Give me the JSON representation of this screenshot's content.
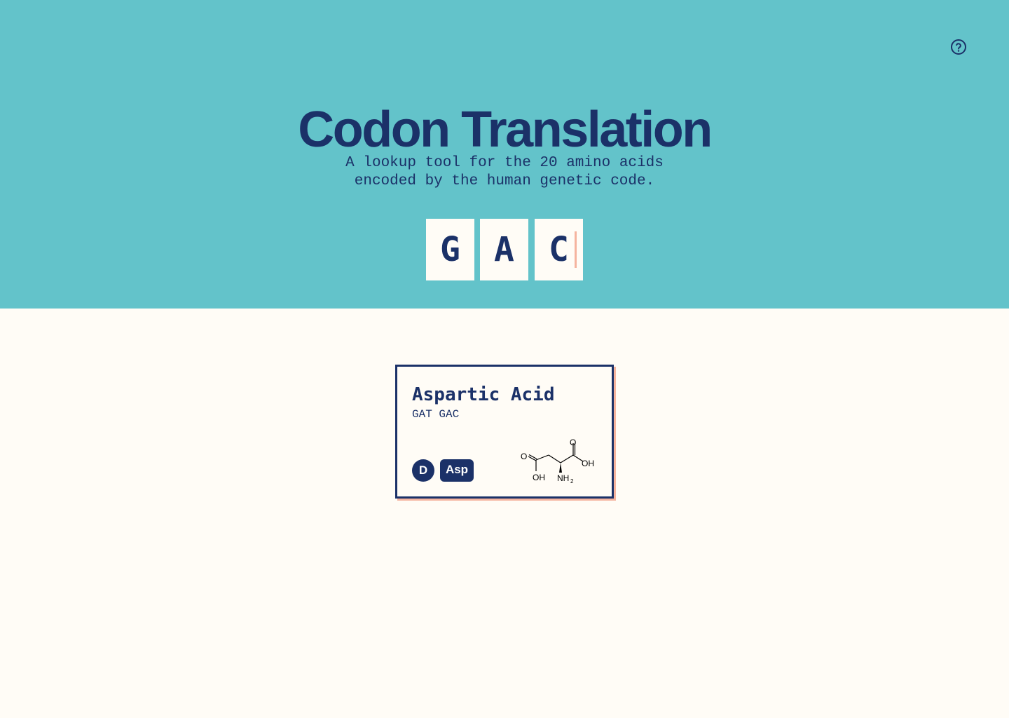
{
  "header": {
    "title": "Codon Translation",
    "subtitle_line1": "A lookup tool for the 20 amino acids",
    "subtitle_line2": "encoded by the human genetic code.",
    "help_icon": "question-circle-icon"
  },
  "codon_input": {
    "bases": [
      "G",
      "A",
      "C"
    ]
  },
  "result_card": {
    "name": "Aspartic Acid",
    "codons": "GAT GAC",
    "one_letter": "D",
    "three_letter": "Asp",
    "structure_labels": {
      "o_left": "O",
      "oh_left": "OH",
      "o_right": "O",
      "oh_right": "OH",
      "nh": "NH",
      "nh_sub": "2"
    }
  },
  "colors": {
    "hero_bg": "#63c3ca",
    "page_bg": "#fffcf6",
    "navy": "#1b3168",
    "accent": "#f5b49f"
  }
}
